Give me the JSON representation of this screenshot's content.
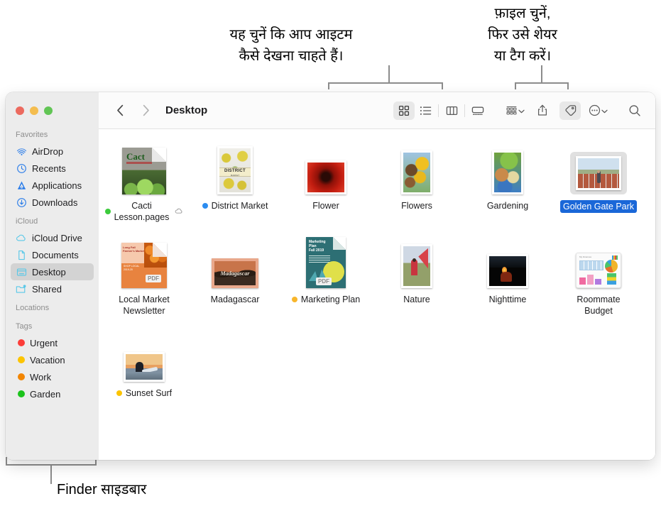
{
  "callouts": [
    {
      "id": "view-options",
      "text": "यह चुनें कि आप आइटम\nकैसे देखना चाहते हैं।"
    },
    {
      "id": "share-tag",
      "text": "फ़ाइल चुनें,\nफिर उसे शेयर\nया टैग करें।"
    },
    {
      "id": "finder-sidebar",
      "text": "Finder साइडबार"
    }
  ],
  "window": {
    "traffic_lights": [
      {
        "name": "close",
        "color": "#ec6a5f"
      },
      {
        "name": "minimize",
        "color": "#f4bd4f"
      },
      {
        "name": "zoom",
        "color": "#61c554"
      }
    ]
  },
  "sidebar": {
    "sections": [
      {
        "header": "Favorites",
        "items": [
          {
            "label": "AirDrop",
            "icon": "airdrop-icon",
            "selected": false
          },
          {
            "label": "Recents",
            "icon": "clock-icon",
            "selected": false
          },
          {
            "label": "Applications",
            "icon": "applications-icon",
            "selected": false
          },
          {
            "label": "Downloads",
            "icon": "download-icon",
            "selected": false
          }
        ]
      },
      {
        "header": "iCloud",
        "items": [
          {
            "label": "iCloud Drive",
            "icon": "cloud-icon",
            "selected": false
          },
          {
            "label": "Documents",
            "icon": "document-icon",
            "selected": false
          },
          {
            "label": "Desktop",
            "icon": "desktop-icon",
            "selected": true
          },
          {
            "label": "Shared",
            "icon": "shared-folder-icon",
            "selected": false
          }
        ]
      },
      {
        "header": "Locations",
        "items": []
      },
      {
        "header": "Tags",
        "items": [
          {
            "label": "Urgent",
            "icon": "tag-dot",
            "color": "#fc3d39",
            "selected": false
          },
          {
            "label": "Vacation",
            "icon": "tag-dot",
            "color": "#fcc400",
            "selected": false
          },
          {
            "label": "Work",
            "icon": "tag-dot",
            "color": "#f28500",
            "selected": false
          },
          {
            "label": "Garden",
            "icon": "tag-dot",
            "color": "#1cc31c",
            "selected": false
          }
        ]
      }
    ]
  },
  "toolbar": {
    "back_label": "Back",
    "forward_label": "Forward",
    "path_label": "Desktop",
    "view_buttons": [
      {
        "name": "icon-view",
        "label": "Icon View",
        "active": true
      },
      {
        "name": "list-view",
        "label": "List View",
        "active": false
      },
      {
        "name": "column-view",
        "label": "Column View",
        "active": false
      },
      {
        "name": "gallery-view",
        "label": "Gallery View",
        "active": false
      }
    ],
    "action_buttons": [
      {
        "name": "group-by",
        "label": "Group",
        "active": false,
        "chevron": true
      },
      {
        "name": "share",
        "label": "Share",
        "active": false,
        "chevron": false
      },
      {
        "name": "tag",
        "label": "Tags",
        "active": true,
        "chevron": false
      },
      {
        "name": "more",
        "label": "More",
        "active": false,
        "chevron": true
      }
    ],
    "search_label": "Search"
  },
  "files": [
    {
      "name": "Cacti\nLesson.pages",
      "kind": "pages-doc",
      "tag": "#3ccb3c",
      "cloud": true,
      "selected": false,
      "col": 0,
      "row": 0
    },
    {
      "name": "District Market",
      "kind": "photo-portrait",
      "tag": "#2b8cf0",
      "cloud": false,
      "selected": false,
      "col": 1,
      "row": 0
    },
    {
      "name": "Flower",
      "kind": "photo-landscape",
      "tag": null,
      "cloud": false,
      "selected": false,
      "col": 2,
      "row": 0
    },
    {
      "name": "Flowers",
      "kind": "photo-portrait",
      "tag": null,
      "cloud": false,
      "selected": false,
      "col": 3,
      "row": 0
    },
    {
      "name": "Gardening",
      "kind": "photo-portrait",
      "tag": null,
      "cloud": false,
      "selected": false,
      "col": 4,
      "row": 0
    },
    {
      "name": "Golden Gate Park",
      "kind": "photo-landscape",
      "tag": null,
      "cloud": false,
      "selected": true,
      "col": 5,
      "row": 0
    },
    {
      "name": "Local Market\nNewsletter",
      "kind": "pdf-doc",
      "tag": null,
      "cloud": false,
      "selected": false,
      "col": 0,
      "row": 1
    },
    {
      "name": "Madagascar",
      "kind": "photo-landscape",
      "tag": null,
      "cloud": false,
      "selected": false,
      "col": 1,
      "row": 1
    },
    {
      "name": "Marketing Plan",
      "kind": "pdf-doc",
      "tag": "#f8b62c",
      "cloud": false,
      "selected": false,
      "col": 2,
      "row": 1
    },
    {
      "name": "Nature",
      "kind": "photo-portrait",
      "tag": null,
      "cloud": false,
      "selected": false,
      "col": 3,
      "row": 1
    },
    {
      "name": "Nighttime",
      "kind": "photo-landscape",
      "tag": null,
      "cloud": false,
      "selected": false,
      "col": 4,
      "row": 1
    },
    {
      "name": "Roommate\nBudget",
      "kind": "numbers-doc",
      "tag": null,
      "cloud": false,
      "selected": false,
      "col": 5,
      "row": 1
    },
    {
      "name": "Sunset Surf",
      "kind": "photo-landscape",
      "tag": "#fcc400",
      "cloud": false,
      "selected": false,
      "col": 0,
      "row": 2
    }
  ]
}
